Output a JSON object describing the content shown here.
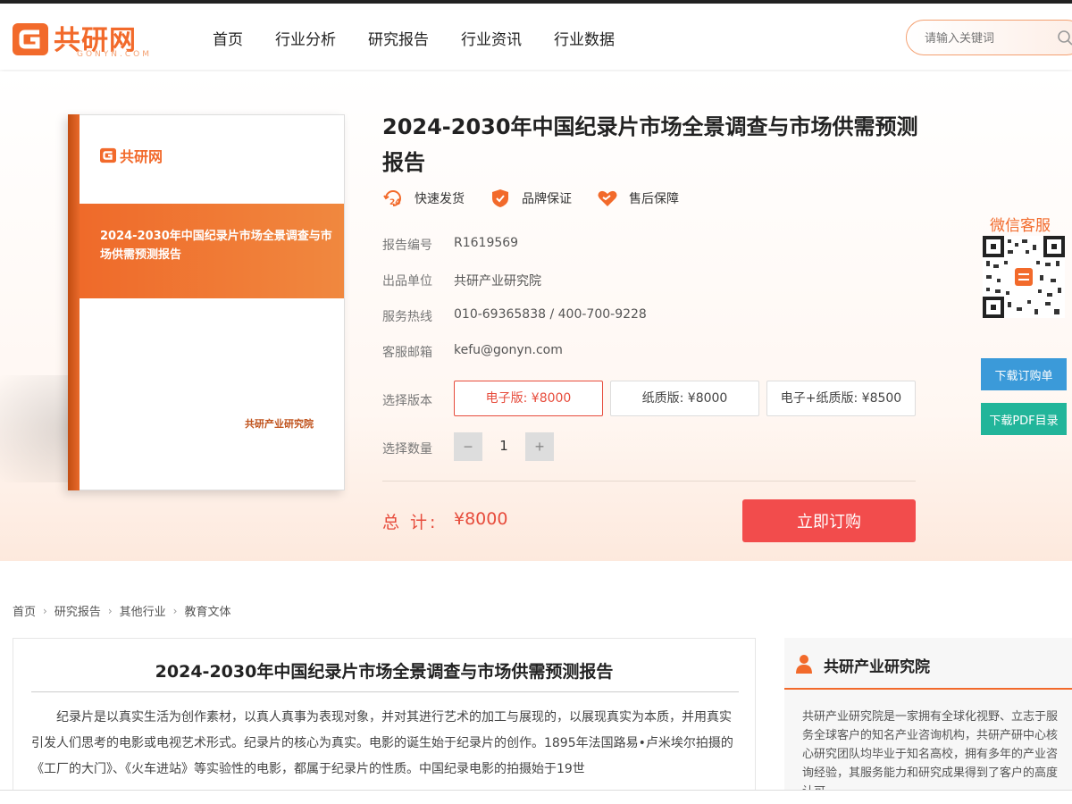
{
  "brand": {
    "name": "共研网",
    "domain": "GONYN.COM"
  },
  "nav": [
    "首页",
    "行业分析",
    "研究报告",
    "行业资讯",
    "行业数据"
  ],
  "search": {
    "placeholder": "请输入关键词"
  },
  "book": {
    "brand": "共研网",
    "title": "2024-2030年中国纪录片市场全景调查与市场供需预测报告",
    "publisher": "共研产业研究院"
  },
  "product": {
    "title": "2024-2030年中国纪录片市场全景调查与市场供需预测报告",
    "guarantees": [
      "快速发货",
      "品牌保证",
      "售后保障"
    ],
    "info": [
      {
        "label": "报告编号",
        "value": "R1619569"
      },
      {
        "label": "出品单位",
        "value": "共研产业研究院"
      },
      {
        "label": "服务热线",
        "value": "010-69365838 / 400-700-9228"
      },
      {
        "label": "客服邮箱",
        "value": "kefu@gonyn.com"
      }
    ],
    "version_label": "选择版本",
    "versions": [
      "电子版: ¥8000",
      "纸质版: ¥8000",
      "电子+纸质版: ¥8500"
    ],
    "selected_version": "电子版: ¥8000",
    "qty_label": "选择数量",
    "qty_minus": "−",
    "qty": "1",
    "qty_plus": "+",
    "total_label": "总 计:",
    "total": "¥8000",
    "buy_label": "立即订购"
  },
  "sidebar": {
    "title": "微信客服",
    "download_order": "下载订购单",
    "download_pdf": "下载PDF目录"
  },
  "breadcrumb": [
    "首页",
    "研究报告",
    "其他行业",
    "教育文体"
  ],
  "article": {
    "title": "2024-2030年中国纪录片市场全景调查与市场供需预测报告",
    "body": "纪录片是以真实生活为创作素材，以真人真事为表现对象，并对其进行艺术的加工与展现的，以展现真实为本质，并用真实引发人们思考的电影或电视艺术形式。纪录片的核心为真实。电影的诞生始于纪录片的创作。1895年法国路易•卢米埃尔拍摄的《工厂的大门》、《火车进站》等实验性的电影，都属于纪录片的性质。中国纪录电影的拍摄始于19世"
  },
  "institute": {
    "title": "共研产业研究院",
    "body": "共研产业研究院是一家拥有全球化视野、立志于服务全球客户的知名产业咨询机构，共研产研中心核心研究团队均毕业于知名高校，拥有多年的产业咨询经验，其服务能力和研究成果得到了客户的高度认可"
  },
  "colors": {
    "accent": "#f26a2b",
    "price": "#e74c3c",
    "buy": "#f24c4c",
    "order_btn": "#3b9ad9",
    "pdf_btn": "#22b59a"
  }
}
